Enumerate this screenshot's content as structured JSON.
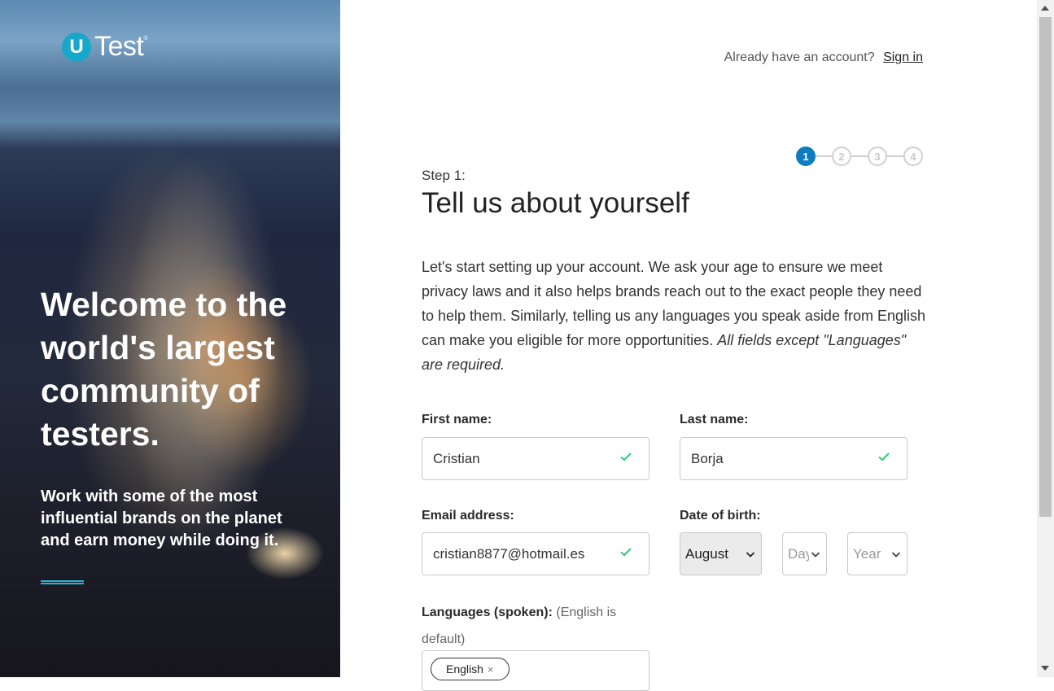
{
  "brand": {
    "logo_letter": "U",
    "logo_text": "Test",
    "logo_tm": "®",
    "accent": "#16a7c9"
  },
  "hero": {
    "title": "Welcome to the world's largest community of testers.",
    "subtitle": "Work with some of the most influential brands on the planet and earn money while doing it."
  },
  "header": {
    "signin_prompt": "Already have an account?",
    "signin_link": "Sign in"
  },
  "stepper": {
    "steps": [
      "1",
      "2",
      "3",
      "4"
    ],
    "active": "1",
    "active_color": "#0f7cc0"
  },
  "form": {
    "step_label": "Step 1:",
    "heading": "Tell us about yourself",
    "intro": "Let's start setting up your account. We ask your age to ensure we meet privacy laws and it also helps brands reach out to the exact people they need to help them. Similarly, telling us any languages you speak aside from English can make you eligible for more opportunities.",
    "intro_emphasis": "All fields except \"Languages\" are required.",
    "first_name": {
      "label": "First name:",
      "value": "Cristian"
    },
    "last_name": {
      "label": "Last name:",
      "value": "Borja"
    },
    "email": {
      "label": "Email address:",
      "value": "cristian8877@hotmail.es"
    },
    "dob": {
      "label": "Date of birth:",
      "month": "August",
      "day": "Day",
      "year": "Year"
    },
    "languages": {
      "label": "Languages (spoken):",
      "note": "(English is default)",
      "chips": [
        "English"
      ],
      "chip_remove": "×"
    }
  },
  "colors": {
    "valid_check": "#2ecc71"
  }
}
